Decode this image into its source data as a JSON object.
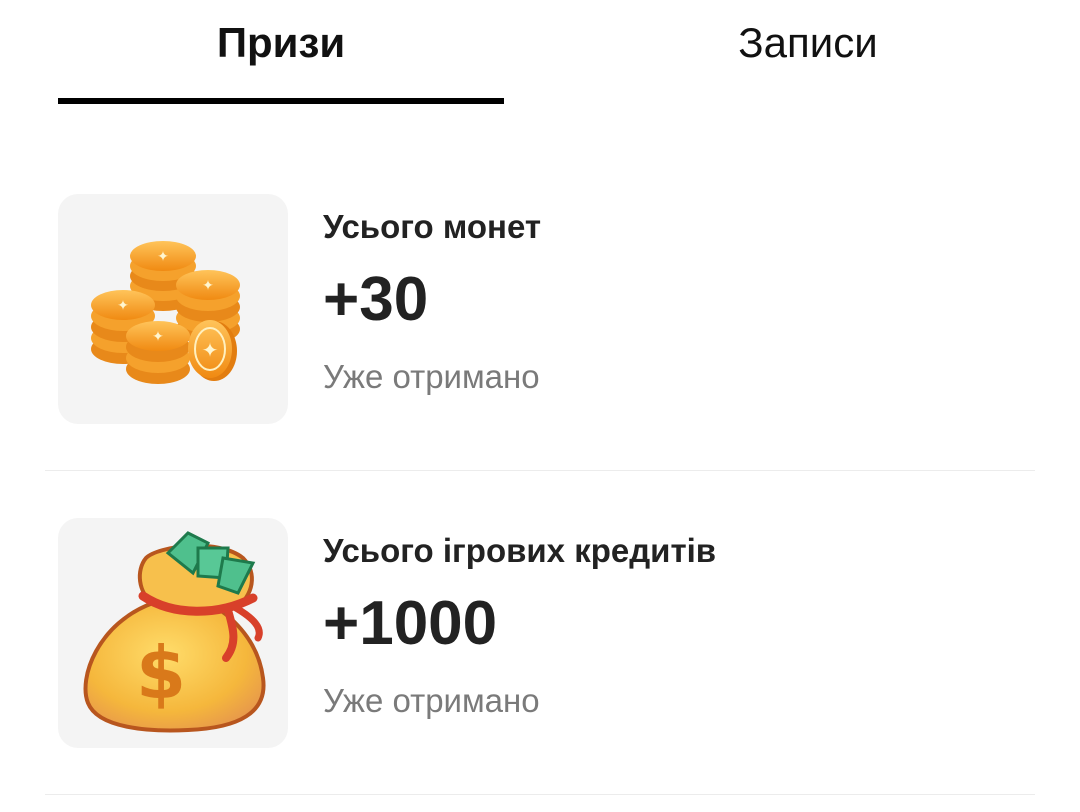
{
  "tabs": [
    {
      "label": "Призи",
      "active": true
    },
    {
      "label": "Записи",
      "active": false
    }
  ],
  "prizes": [
    {
      "icon": "gold-coins-icon",
      "title": "Усього монет",
      "amount": "+30",
      "status": "Уже отримано"
    },
    {
      "icon": "money-bag-icon",
      "title": "Усього ігрових кредитів",
      "amount": "+1000",
      "status": "Уже отримано"
    }
  ],
  "colors": {
    "active_tab_underline": "#000000",
    "thumb_background": "#f4f4f4",
    "status_text": "#7a7a7a",
    "coin": "#f7a12a",
    "bag": "#f5b73c"
  }
}
